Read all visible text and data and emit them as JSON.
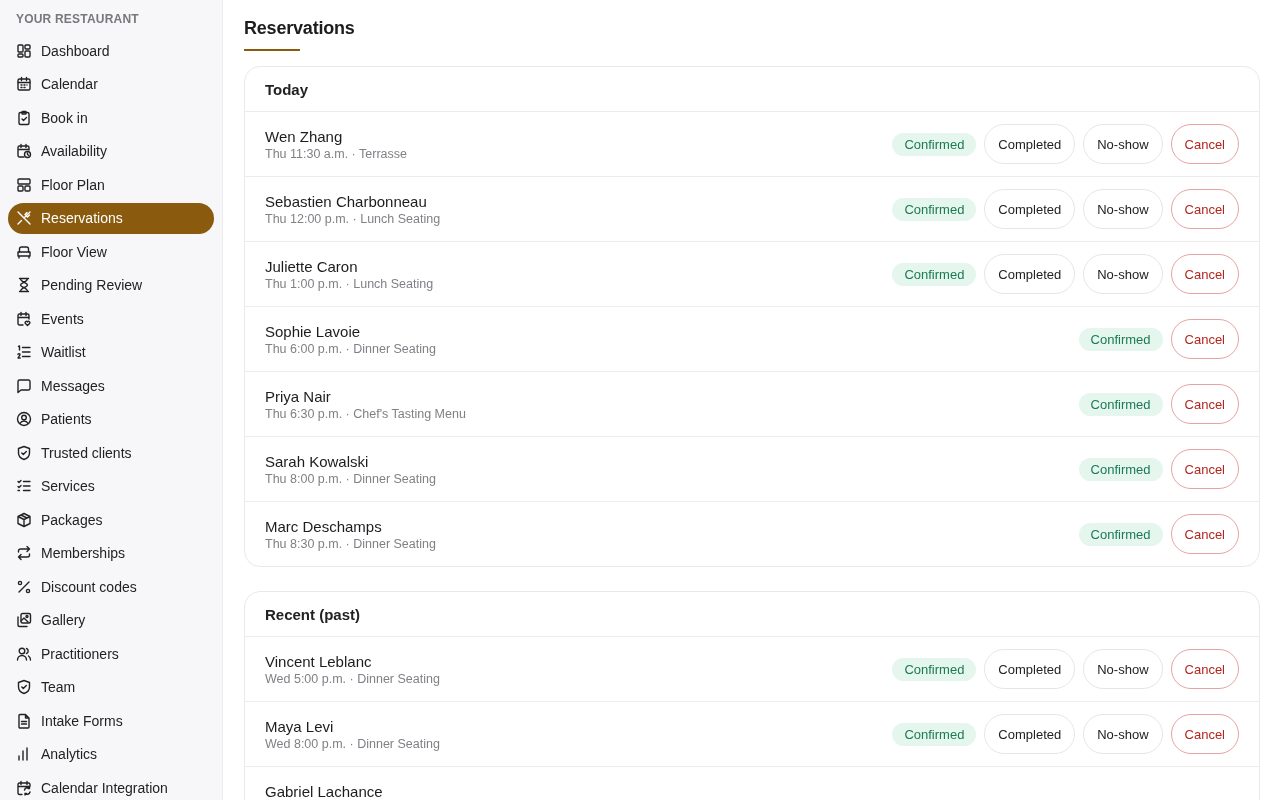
{
  "sidebar": {
    "heading": "YOUR RESTAURANT",
    "items": [
      {
        "label": "Dashboard",
        "selected": false
      },
      {
        "label": "Calendar",
        "selected": false
      },
      {
        "label": "Book in",
        "selected": false
      },
      {
        "label": "Availability",
        "selected": false
      },
      {
        "label": "Floor Plan",
        "selected": false
      },
      {
        "label": "Reservations",
        "selected": true
      },
      {
        "label": "Floor View",
        "selected": false
      },
      {
        "label": "Pending Review",
        "selected": false
      },
      {
        "label": "Events",
        "selected": false
      },
      {
        "label": "Waitlist",
        "selected": false
      },
      {
        "label": "Messages",
        "selected": false
      },
      {
        "label": "Patients",
        "selected": false
      },
      {
        "label": "Trusted clients",
        "selected": false
      },
      {
        "label": "Services",
        "selected": false
      },
      {
        "label": "Packages",
        "selected": false
      },
      {
        "label": "Memberships",
        "selected": false
      },
      {
        "label": "Discount codes",
        "selected": false
      },
      {
        "label": "Gallery",
        "selected": false
      },
      {
        "label": "Practitioners",
        "selected": false
      },
      {
        "label": "Team",
        "selected": false
      },
      {
        "label": "Intake Forms",
        "selected": false
      },
      {
        "label": "Analytics",
        "selected": false
      },
      {
        "label": "Calendar Integration",
        "selected": false
      }
    ]
  },
  "page": {
    "title": "Reservations"
  },
  "sections": [
    {
      "title": "Today",
      "reservations": [
        {
          "name": "Wen Zhang",
          "details": "Thu 11:30 a.m. · Terrasse",
          "status": "Confirmed",
          "actions": [
            {
              "label": "Completed",
              "kind": "neutral"
            },
            {
              "label": "No-show",
              "kind": "neutral"
            },
            {
              "label": "Cancel",
              "kind": "danger"
            }
          ]
        },
        {
          "name": "Sebastien Charbonneau",
          "details": "Thu 12:00 p.m. · Lunch Seating",
          "status": "Confirmed",
          "actions": [
            {
              "label": "Completed",
              "kind": "neutral"
            },
            {
              "label": "No-show",
              "kind": "neutral"
            },
            {
              "label": "Cancel",
              "kind": "danger"
            }
          ]
        },
        {
          "name": "Juliette Caron",
          "details": "Thu 1:00 p.m. · Lunch Seating",
          "status": "Confirmed",
          "actions": [
            {
              "label": "Completed",
              "kind": "neutral"
            },
            {
              "label": "No-show",
              "kind": "neutral"
            },
            {
              "label": "Cancel",
              "kind": "danger"
            }
          ]
        },
        {
          "name": "Sophie Lavoie",
          "details": "Thu 6:00 p.m. · Dinner Seating",
          "status": "Confirmed",
          "actions": [
            {
              "label": "Cancel",
              "kind": "danger"
            }
          ]
        },
        {
          "name": "Priya Nair",
          "details": "Thu 6:30 p.m. · Chef's Tasting Menu",
          "status": "Confirmed",
          "actions": [
            {
              "label": "Cancel",
              "kind": "danger"
            }
          ]
        },
        {
          "name": "Sarah Kowalski",
          "details": "Thu 8:00 p.m. · Dinner Seating",
          "status": "Confirmed",
          "actions": [
            {
              "label": "Cancel",
              "kind": "danger"
            }
          ]
        },
        {
          "name": "Marc Deschamps",
          "details": "Thu 8:30 p.m. · Dinner Seating",
          "status": "Confirmed",
          "actions": [
            {
              "label": "Cancel",
              "kind": "danger"
            }
          ]
        }
      ]
    },
    {
      "title": "Recent (past)",
      "reservations": [
        {
          "name": "Vincent Leblanc",
          "details": "Wed 5:00 p.m. · Dinner Seating",
          "status": "Confirmed",
          "actions": [
            {
              "label": "Completed",
              "kind": "neutral"
            },
            {
              "label": "No-show",
              "kind": "neutral"
            },
            {
              "label": "Cancel",
              "kind": "danger"
            }
          ]
        },
        {
          "name": "Maya Levi",
          "details": "Wed 8:00 p.m. · Dinner Seating",
          "status": "Confirmed",
          "actions": [
            {
              "label": "Completed",
              "kind": "neutral"
            },
            {
              "label": "No-show",
              "kind": "neutral"
            },
            {
              "label": "Cancel",
              "kind": "danger"
            }
          ]
        },
        {
          "name": "Gabriel Lachance"
        }
      ]
    }
  ]
}
